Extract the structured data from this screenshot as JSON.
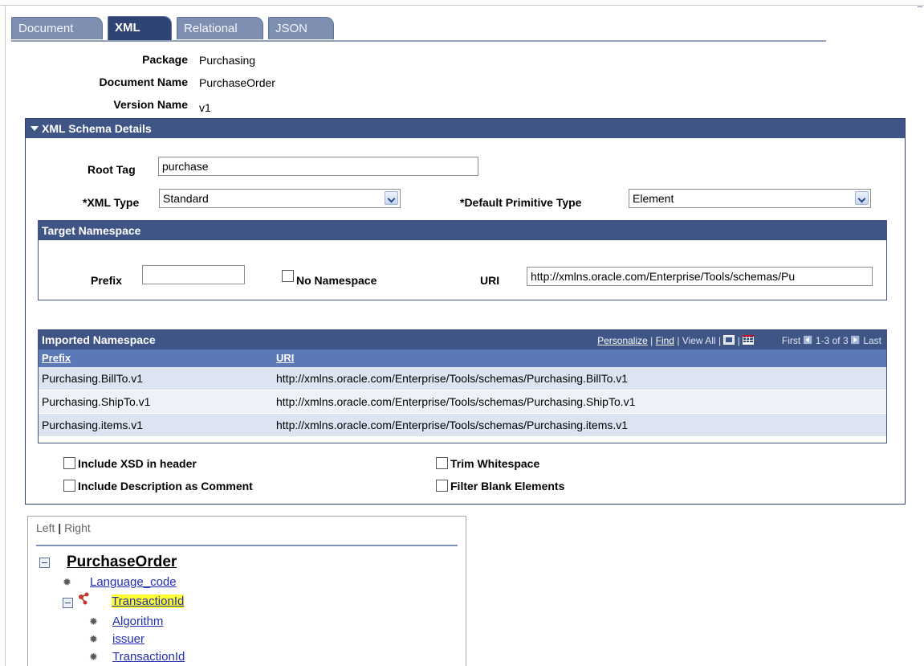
{
  "tabs": [
    {
      "label": "Document"
    },
    {
      "label": "XML"
    },
    {
      "label": "Relational"
    },
    {
      "label": "JSON"
    }
  ],
  "header": {
    "package_label": "Package",
    "package_value": "Purchasing",
    "docname_label": "Document Name",
    "docname_value": "PurchaseOrder",
    "version_label": "Version Name",
    "version_value": "v1"
  },
  "schema": {
    "title": "XML Schema Details",
    "root_tag_label": "Root Tag",
    "root_tag_value": "purchase",
    "xml_type_label": "*XML Type",
    "xml_type_value": "Standard",
    "default_primitive_label": "*Default Primitive Type",
    "default_primitive_value": "Element"
  },
  "target_ns": {
    "title": "Target Namespace",
    "prefix_label": "Prefix",
    "prefix_value": "",
    "no_namespace_label": "No Namespace",
    "uri_label": "URI",
    "uri_value": "http://xmlns.oracle.com/Enterprise/Tools/schemas/Pu"
  },
  "imported_ns": {
    "title": "Imported Namespace",
    "personalize": "Personalize",
    "find": "Find",
    "view_all": "View All",
    "first": "First",
    "range": "1-3 of 3",
    "last": "Last",
    "columns": [
      "Prefix",
      "URI"
    ],
    "rows": [
      {
        "prefix": "Purchasing.BillTo.v1",
        "uri": "http://xmlns.oracle.com/Enterprise/Tools/schemas/Purchasing.BillTo.v1"
      },
      {
        "prefix": "Purchasing.ShipTo.v1",
        "uri": "http://xmlns.oracle.com/Enterprise/Tools/schemas/Purchasing.ShipTo.v1"
      },
      {
        "prefix": "Purchasing.items.v1",
        "uri": "http://xmlns.oracle.com/Enterprise/Tools/schemas/Purchasing.items.v1"
      }
    ]
  },
  "options": {
    "include_xsd": "Include XSD in header",
    "include_desc": "Include Description as Comment",
    "trim_ws": "Trim Whitespace",
    "filter_blank": "Filter Blank Elements"
  },
  "tree": {
    "left": "Left",
    "sep": "|",
    "right": "Right",
    "root": "PurchaseOrder",
    "nodes": [
      "Language_code",
      "TransactionId",
      "Algorithm",
      "issuer",
      "TransactionId"
    ]
  },
  "colors": {
    "header_bg": "#3e5585",
    "active_tab": "#2f4474",
    "highlight": "#ffff33"
  }
}
